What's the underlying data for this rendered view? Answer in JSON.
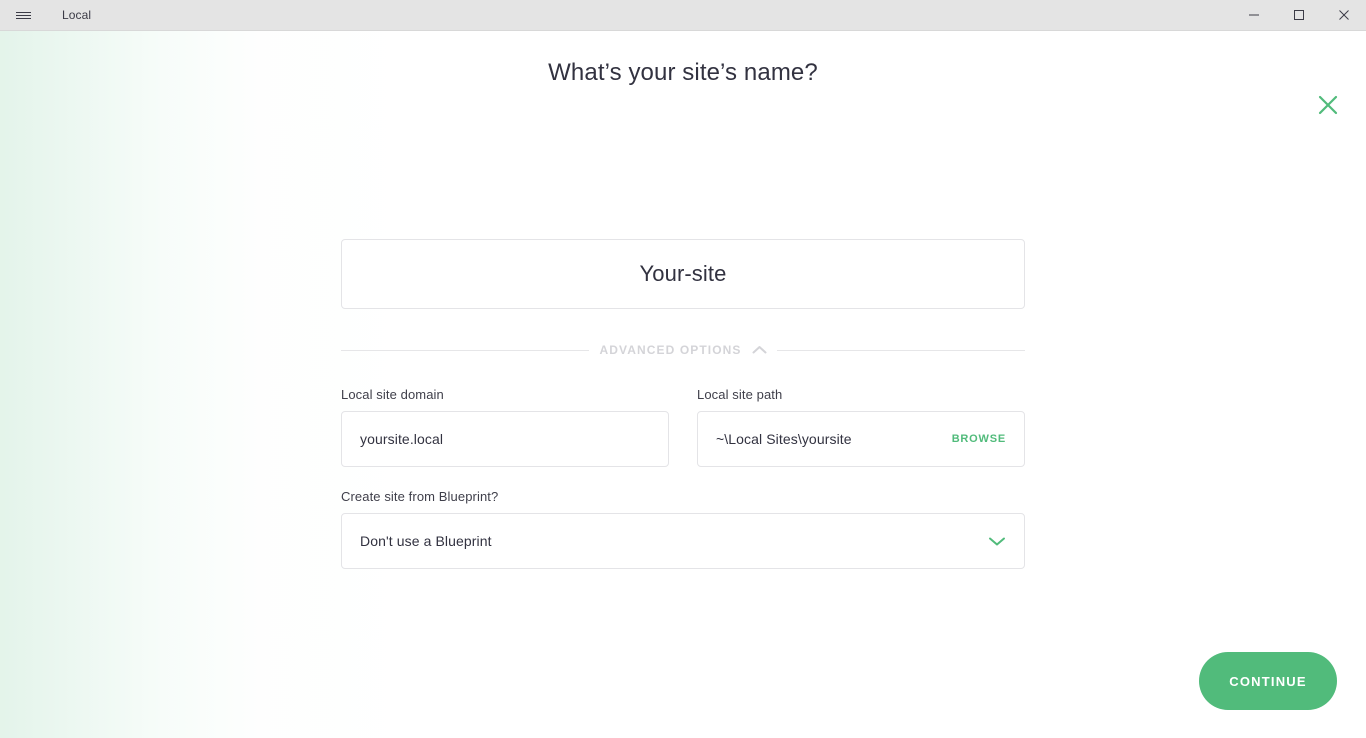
{
  "window": {
    "title": "Local",
    "menu_icon": "hamburger-icon",
    "controls": {
      "minimize": "minimize-icon",
      "maximize": "maximize-icon",
      "close": "close-icon"
    }
  },
  "modal": {
    "headline": "What’s your site’s name?",
    "close_icon": "close-icon",
    "close_color": "#51bb7b"
  },
  "site_name": {
    "value": "Your-site"
  },
  "advanced": {
    "label": "ADVANCED OPTIONS",
    "chevron_icon": "chevron-up-icon",
    "expanded": true
  },
  "domain": {
    "label": "Local site domain",
    "value": "yoursite.local"
  },
  "path": {
    "label": "Local site path",
    "value": "~\\Local Sites\\yoursite",
    "browse_label": "BROWSE",
    "browse_color": "#51bb7b"
  },
  "blueprint": {
    "label": "Create site from Blueprint?",
    "selected": "Don't use a Blueprint",
    "chevron_icon": "chevron-down-icon",
    "chevron_color": "#51bb7b"
  },
  "footer": {
    "continue_label": "CONTINUE",
    "accent_color": "#51bb7b"
  }
}
